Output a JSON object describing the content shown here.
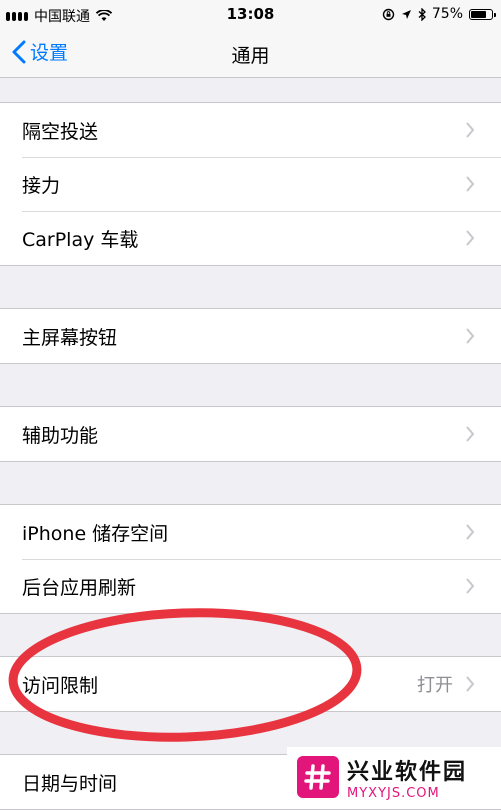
{
  "status_bar": {
    "carrier": "中国联通",
    "time": "13:08",
    "battery": "75%",
    "battery_level": 0.75
  },
  "nav": {
    "back_label": "设置",
    "title": "通用"
  },
  "groups": [
    {
      "rows": [
        {
          "label": "隔空投送"
        },
        {
          "label": "接力"
        },
        {
          "label": "CarPlay 车载"
        }
      ]
    },
    {
      "rows": [
        {
          "label": "主屏幕按钮"
        }
      ]
    },
    {
      "rows": [
        {
          "label": "辅助功能"
        }
      ]
    },
    {
      "rows": [
        {
          "label": "iPhone 储存空间"
        },
        {
          "label": "后台应用刷新"
        }
      ]
    },
    {
      "rows": [
        {
          "label": "访问限制",
          "value": "打开"
        }
      ]
    },
    {
      "rows": [
        {
          "label": "日期与时间"
        }
      ]
    }
  ],
  "annotation": {
    "color": "#e8343f"
  },
  "watermark": {
    "name": "兴业软件园",
    "url": "MYXYJS.COM",
    "color": "#e2157a"
  }
}
